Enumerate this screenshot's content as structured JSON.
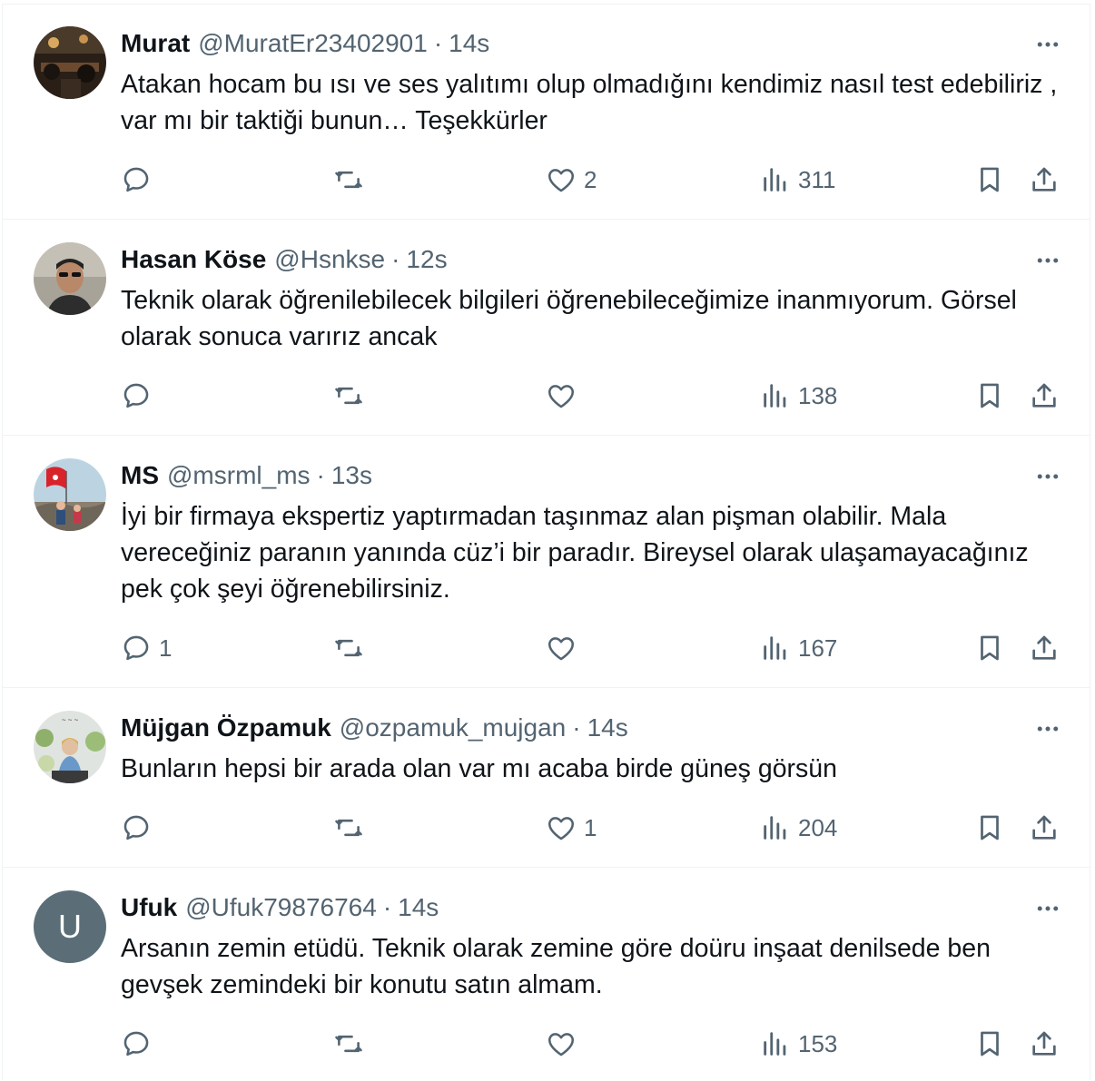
{
  "tweets": [
    {
      "name": "Murat",
      "handle": "@MuratEr23402901",
      "time": "14s",
      "text": "Atakan hocam bu ısı ve ses yalıtımı olup olmadığını kendimiz nasıl test edebiliriz , var mı bir taktiği bunun… Teşekkürler",
      "replies": "",
      "retweets": "",
      "likes": "2",
      "views": "311",
      "avatar": "photo-dinner"
    },
    {
      "name": "Hasan Köse",
      "handle": "@Hsnkse",
      "time": "12s",
      "text": "Teknik olarak öğrenilebilecek bilgileri öğrenebileceğimize inanmıyorum. Görsel olarak sonuca varırız ancak",
      "replies": "",
      "retweets": "",
      "likes": "",
      "views": "138",
      "avatar": "photo-man-sunglasses"
    },
    {
      "name": "MS",
      "handle": "@msrml_ms",
      "time": "13s",
      "text": "İyi bir firmaya ekspertiz yaptırmadan taşınmaz alan pişman olabilir. Mala vereceğiniz paranın yanında cüz’i bir paradır. Bireysel olarak ulaşamayacağınız  pek çok şeyi öğrenebilirsiniz.",
      "replies": "1",
      "retweets": "",
      "likes": "",
      "views": "167",
      "avatar": "photo-children-flag"
    },
    {
      "name": "Müjgan Özpamuk",
      "handle": "@ozpamuk_mujgan",
      "time": "14s",
      "text": "Bunların hepsi bir arada olan var mı acaba birde güneş görsün",
      "replies": "",
      "retweets": "",
      "likes": "1",
      "views": "204",
      "avatar": "photo-woman-flowers"
    },
    {
      "name": "Ufuk",
      "handle": "@Ufuk79876764",
      "time": "14s",
      "text": "Arsanın zemin etüdü. Teknik olarak zemine göre doüru inşaat denilsede ben gevşek zemindeki bir konutu satın almam.",
      "replies": "",
      "retweets": "",
      "likes": "",
      "views": "153",
      "avatar_letter": "U"
    }
  ],
  "icons": {
    "reply": "reply-icon",
    "retweet": "retweet-icon",
    "like": "heart-icon",
    "views": "views-icon",
    "bookmark": "bookmark-icon",
    "share": "share-icon",
    "more": "more-icon"
  },
  "colors": {
    "text": "#0f1419",
    "secondary": "#536471",
    "border": "#eff3f4",
    "letter_avatar": "#5b6e77"
  }
}
